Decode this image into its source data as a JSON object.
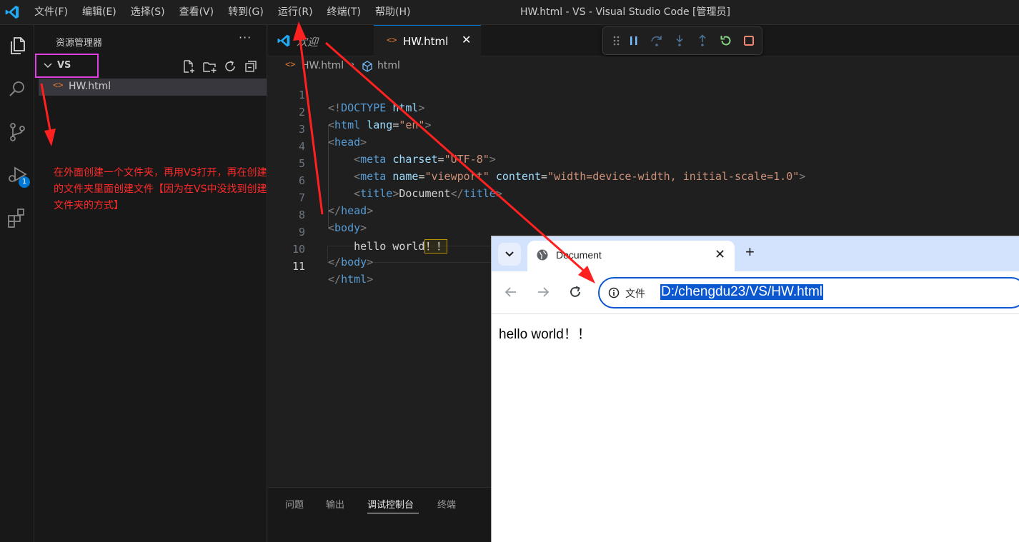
{
  "titlebar": {
    "menus": [
      "文件(F)",
      "编辑(E)",
      "选择(S)",
      "查看(V)",
      "转到(G)",
      "运行(R)",
      "终端(T)",
      "帮助(H)"
    ],
    "window_title": "HW.html - VS - Visual Studio Code [管理员]"
  },
  "activity_bar": {
    "items": [
      "files-icon",
      "search-icon",
      "source-control-icon",
      "run-debug-icon",
      "extensions-icon"
    ],
    "debug_badge": "1"
  },
  "explorer": {
    "title": "资源管理器",
    "more": "···",
    "folder": "VS",
    "file": "HW.html"
  },
  "annotation": "在外面创建一个文件夹，再用VS打开，再在创建的文件夹里面创建文件【因为在VS中没找到创建文件夹的方式】",
  "tabs": {
    "welcome": "欢迎",
    "active": "HW.html",
    "close": "✕"
  },
  "breadcrumb": {
    "file": "HW.html",
    "element": "html"
  },
  "editor": {
    "current_line": 11,
    "line_numbers": [
      "1",
      "2",
      "3",
      "4",
      "5",
      "6",
      "7",
      "8",
      "9",
      "10",
      "11"
    ]
  },
  "panel": {
    "tabs": [
      "问题",
      "输出",
      "调试控制台",
      "终端"
    ],
    "active_tab": "调试控制台"
  },
  "browser": {
    "tab_title": "Document",
    "tab_close": "✕",
    "new_tab": "+",
    "omnibox_label": "文件",
    "url": "D:/chengdu23/VS/HW.html",
    "content": "hello world！！"
  },
  "colors": {
    "annotation": "#ff2a2a",
    "highlight_box": "#e040e0",
    "accent": "#0078d4",
    "selection": "#0b57d0"
  }
}
